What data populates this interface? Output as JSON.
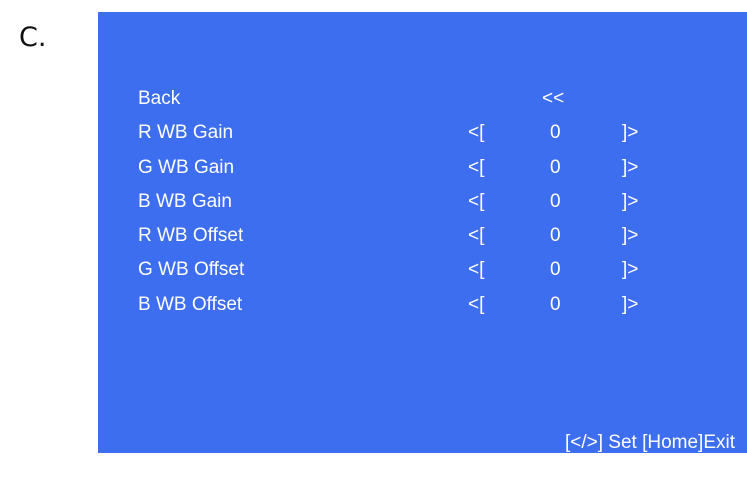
{
  "figure_label": "C.",
  "menu": {
    "back": {
      "label": "Back",
      "marker": "<<"
    },
    "items": [
      {
        "label": "R WB Gain",
        "left": "<[",
        "value": "0",
        "right": "]>"
      },
      {
        "label": "G WB Gain",
        "left": "<[",
        "value": "0",
        "right": "]>"
      },
      {
        "label": "B WB Gain",
        "left": "<[",
        "value": "0",
        "right": "]>"
      },
      {
        "label": "R WB Offset",
        "left": "<[",
        "value": "0",
        "right": "]>"
      },
      {
        "label": "G WB Offset",
        "left": "<[",
        "value": "0",
        "right": "]>"
      },
      {
        "label": "B WB Offset",
        "left": "<[",
        "value": "0",
        "right": "]>"
      }
    ]
  },
  "footer": {
    "hint": "[</>] Set [Home]Exit"
  },
  "colors": {
    "panel_background": "#3d6ef0",
    "text": "#ffffff"
  }
}
